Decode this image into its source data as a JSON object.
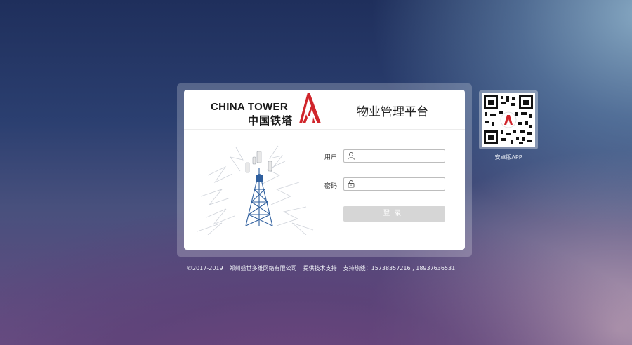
{
  "brand": {
    "logo_en": "CHINA TOWER",
    "logo_zh": "中国铁塔",
    "platform_title": "物业管理平台",
    "accent_color": "#d0252b"
  },
  "login": {
    "username_label": "用户:",
    "username_icon": "user-icon",
    "username_value": "",
    "password_label": "密码:",
    "password_icon": "lock-icon",
    "password_value": "",
    "submit_label": "登录"
  },
  "app_download": {
    "qr_icon": "qr-code",
    "label": "安卓版APP"
  },
  "footer": {
    "copyright": "©2017-2019",
    "company": "郑州盛世多维网络有限公司",
    "support_text": "提供技术支持",
    "hotline": "支持热线：15738357216 , 18937636531"
  }
}
